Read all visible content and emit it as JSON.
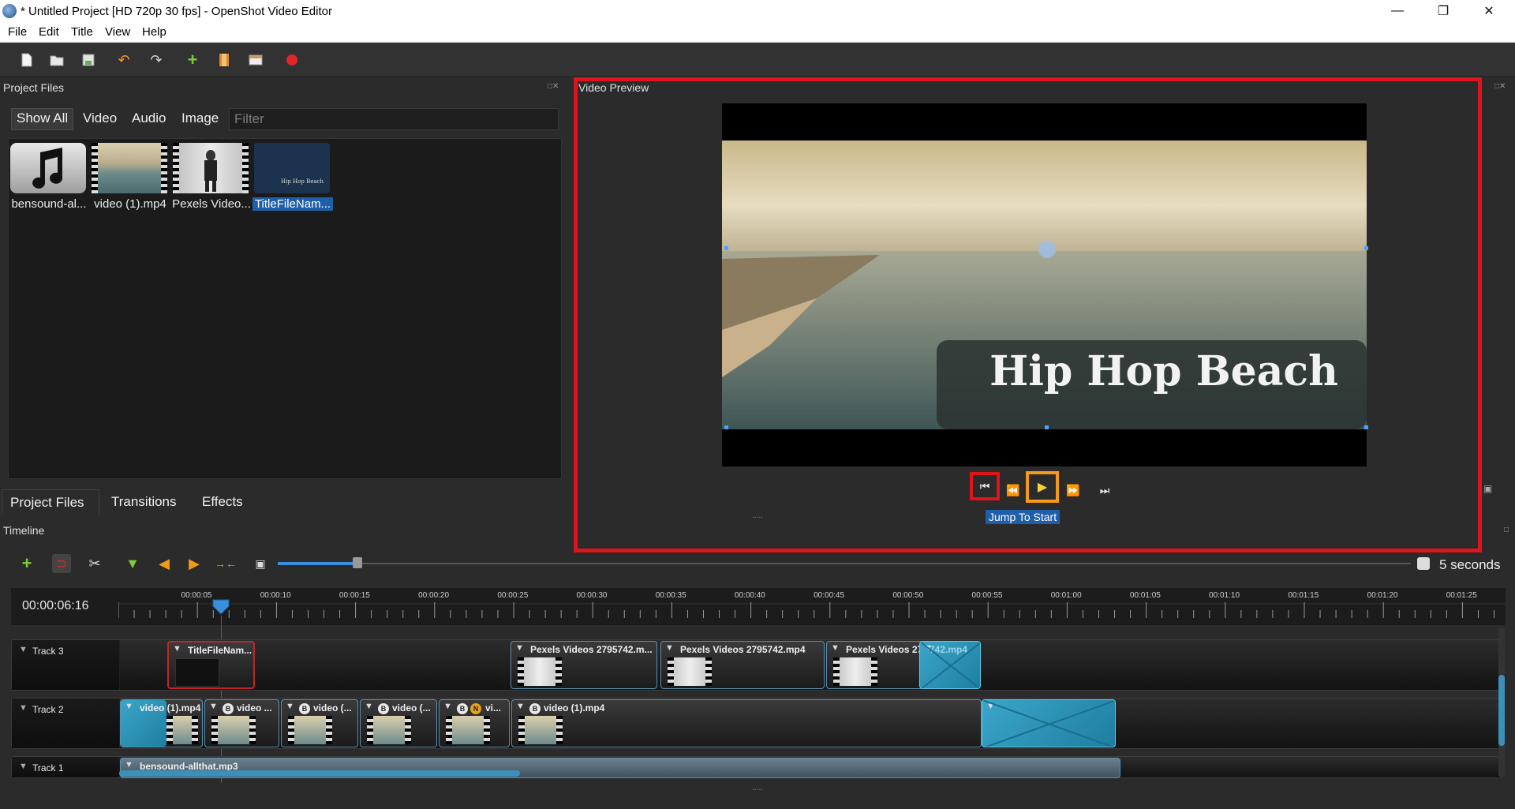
{
  "window": {
    "title": "* Untitled Project [HD 720p 30 fps] - OpenShot Video Editor"
  },
  "menu": [
    "File",
    "Edit",
    "Title",
    "View",
    "Help"
  ],
  "project_files": {
    "title": "Project Files",
    "filters": [
      "Show All",
      "Video",
      "Audio",
      "Image"
    ],
    "filter_placeholder": "Filter",
    "items": [
      {
        "label": "bensound-al...",
        "icon": "music-note-icon"
      },
      {
        "label": "video (1).mp4"
      },
      {
        "label": "Pexels Video..."
      },
      {
        "label": "TitleFileNam...",
        "selected": true,
        "thumb_text": "Hip Hop Beach"
      }
    ]
  },
  "bottom_tabs": [
    "Project Files",
    "Transitions",
    "Effects"
  ],
  "video_preview": {
    "title": "Video Preview",
    "overlay_title": "Hip Hop Beach",
    "tooltip": "Jump To Start"
  },
  "timeline": {
    "title": "Timeline",
    "current_time": "00:00:06:16",
    "zoom_label": "5 seconds",
    "ruler": [
      "00:00:05",
      "00:00:10",
      "00:00:15",
      "00:00:20",
      "00:00:25",
      "00:00:30",
      "00:00:35",
      "00:00:40",
      "00:00:45",
      "00:00:50",
      "00:00:55",
      "00:01:00",
      "00:01:05",
      "00:01:10",
      "00:01:15",
      "00:01:20",
      "00:01:25"
    ],
    "tracks": [
      {
        "name": "Track 3",
        "clips": [
          "TitleFileNam...",
          "Pexels Videos 2795742.m...",
          "Pexels Videos 2795742.mp4",
          "Pexels Videos 27",
          "742.mp4"
        ]
      },
      {
        "name": "Track 2",
        "clips": [
          "video (1).mp4",
          "video ...",
          "video (...",
          "video (...",
          "vi...",
          "video (1).mp4"
        ]
      },
      {
        "name": "Track 1",
        "clips": [
          "bensound-allthat.mp3"
        ]
      }
    ]
  },
  "colors": {
    "accent": "#1f5ea8",
    "highlight_red": "#e0141c",
    "highlight_orange": "#f39a1b",
    "clip_border": "#5b8fb0"
  }
}
